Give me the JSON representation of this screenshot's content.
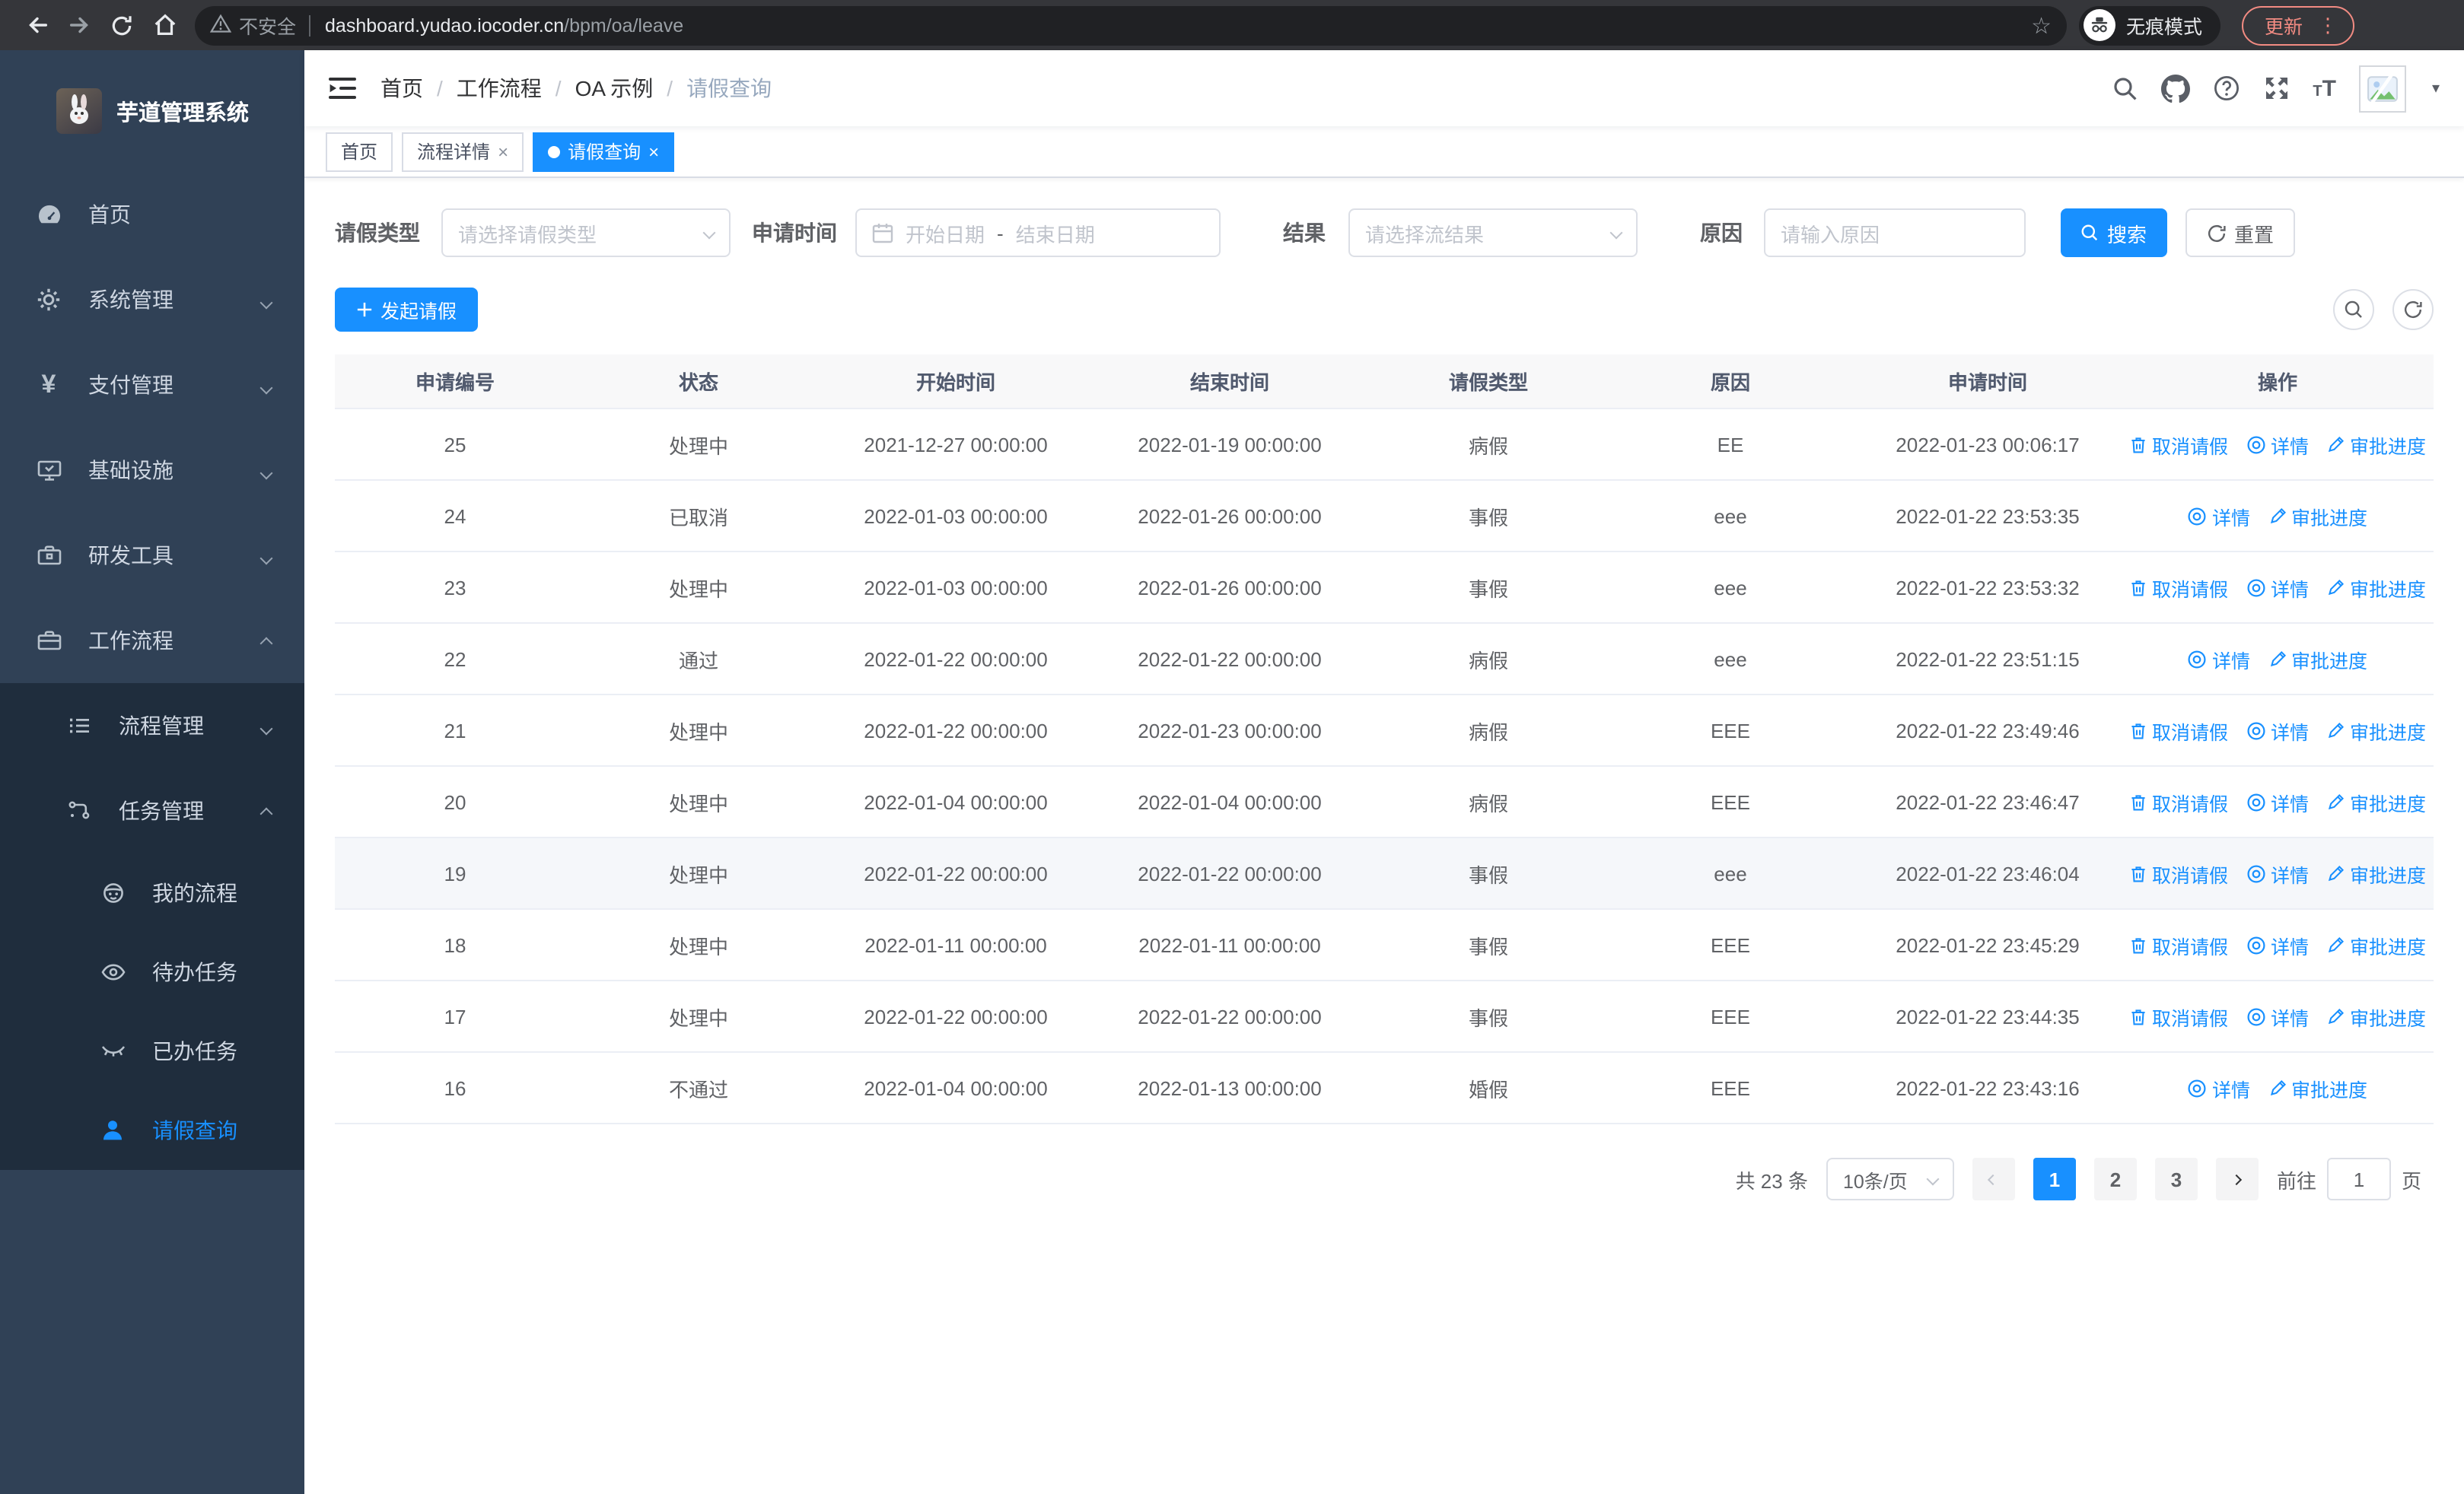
{
  "browser": {
    "security_label": "不安全",
    "url_host": "dashboard.yudao.iocoder.cn",
    "url_path": "/bpm/oa/leave",
    "incognito_label": "无痕模式",
    "update_label": "更新"
  },
  "sidebar": {
    "title": "芋道管理系统",
    "items": [
      {
        "label": "首页",
        "icon": "dashboard-icon",
        "level": 1
      },
      {
        "label": "系统管理",
        "icon": "gear-icon",
        "level": 1,
        "arrow": "down"
      },
      {
        "label": "支付管理",
        "icon": "yen-icon",
        "level": 1,
        "arrow": "down"
      },
      {
        "label": "基础设施",
        "icon": "monitor-icon",
        "level": 1,
        "arrow": "down"
      },
      {
        "label": "研发工具",
        "icon": "toolbox-icon",
        "level": 1,
        "arrow": "down"
      },
      {
        "label": "工作流程",
        "icon": "briefcase-icon",
        "level": 1,
        "arrow": "up"
      },
      {
        "label": "流程管理",
        "icon": "list-icon",
        "level": 2,
        "arrow": "down"
      },
      {
        "label": "任务管理",
        "icon": "flow-icon",
        "level": 2,
        "arrow": "up"
      },
      {
        "label": "我的流程",
        "icon": "robot-icon",
        "level": 3
      },
      {
        "label": "待办任务",
        "icon": "eye-icon",
        "level": 3
      },
      {
        "label": "已办任务",
        "icon": "eye-closed-icon",
        "level": 3
      },
      {
        "label": "请假查询",
        "icon": "user-icon",
        "level": 3,
        "active": true
      }
    ]
  },
  "breadcrumb": {
    "items": [
      "首页",
      "工作流程",
      "OA 示例",
      "请假查询"
    ]
  },
  "tabs": [
    {
      "label": "首页"
    },
    {
      "label": "流程详情",
      "closable": true
    },
    {
      "label": "请假查询",
      "closable": true,
      "active": true
    }
  ],
  "filters": {
    "leave_type_label": "请假类型",
    "leave_type_placeholder": "请选择请假类型",
    "apply_time_label": "申请时间",
    "start_date_placeholder": "开始日期",
    "range_separator": "-",
    "end_date_placeholder": "结束日期",
    "result_label": "结果",
    "result_placeholder": "请选择流结果",
    "reason_label": "原因",
    "reason_placeholder": "请输入原因",
    "search_label": "搜索",
    "reset_label": "重置"
  },
  "toolbar": {
    "create_label": "发起请假"
  },
  "table": {
    "columns": [
      "申请编号",
      "状态",
      "开始时间",
      "结束时间",
      "请假类型",
      "原因",
      "申请时间",
      "操作"
    ],
    "action_labels": {
      "cancel": "取消请假",
      "detail": "详情",
      "progress": "审批进度"
    },
    "rows": [
      {
        "id": "25",
        "status": "处理中",
        "start": "2021-12-27 00:00:00",
        "end": "2022-01-19 00:00:00",
        "type": "病假",
        "reason": "EE",
        "applied": "2022-01-23 00:06:17",
        "actions": [
          "cancel",
          "detail",
          "progress"
        ]
      },
      {
        "id": "24",
        "status": "已取消",
        "start": "2022-01-03 00:00:00",
        "end": "2022-01-26 00:00:00",
        "type": "事假",
        "reason": "eee",
        "applied": "2022-01-22 23:53:35",
        "actions": [
          "detail",
          "progress"
        ]
      },
      {
        "id": "23",
        "status": "处理中",
        "start": "2022-01-03 00:00:00",
        "end": "2022-01-26 00:00:00",
        "type": "事假",
        "reason": "eee",
        "applied": "2022-01-22 23:53:32",
        "actions": [
          "cancel",
          "detail",
          "progress"
        ]
      },
      {
        "id": "22",
        "status": "通过",
        "start": "2022-01-22 00:00:00",
        "end": "2022-01-22 00:00:00",
        "type": "病假",
        "reason": "eee",
        "applied": "2022-01-22 23:51:15",
        "actions": [
          "detail",
          "progress"
        ]
      },
      {
        "id": "21",
        "status": "处理中",
        "start": "2022-01-22 00:00:00",
        "end": "2022-01-23 00:00:00",
        "type": "病假",
        "reason": "EEE",
        "applied": "2022-01-22 23:49:46",
        "actions": [
          "cancel",
          "detail",
          "progress"
        ]
      },
      {
        "id": "20",
        "status": "处理中",
        "start": "2022-01-04 00:00:00",
        "end": "2022-01-04 00:00:00",
        "type": "病假",
        "reason": "EEE",
        "applied": "2022-01-22 23:46:47",
        "actions": [
          "cancel",
          "detail",
          "progress"
        ]
      },
      {
        "id": "19",
        "status": "处理中",
        "start": "2022-01-22 00:00:00",
        "end": "2022-01-22 00:00:00",
        "type": "事假",
        "reason": "eee",
        "applied": "2022-01-22 23:46:04",
        "actions": [
          "cancel",
          "detail",
          "progress"
        ],
        "highlight": true
      },
      {
        "id": "18",
        "status": "处理中",
        "start": "2022-01-11 00:00:00",
        "end": "2022-01-11 00:00:00",
        "type": "事假",
        "reason": "EEE",
        "applied": "2022-01-22 23:45:29",
        "actions": [
          "cancel",
          "detail",
          "progress"
        ]
      },
      {
        "id": "17",
        "status": "处理中",
        "start": "2022-01-22 00:00:00",
        "end": "2022-01-22 00:00:00",
        "type": "事假",
        "reason": "EEE",
        "applied": "2022-01-22 23:44:35",
        "actions": [
          "cancel",
          "detail",
          "progress"
        ]
      },
      {
        "id": "16",
        "status": "不通过",
        "start": "2022-01-04 00:00:00",
        "end": "2022-01-13 00:00:00",
        "type": "婚假",
        "reason": "EEE",
        "applied": "2022-01-22 23:43:16",
        "actions": [
          "detail",
          "progress"
        ]
      }
    ]
  },
  "pagination": {
    "total_label": "共 23 条",
    "page_size": "10条/页",
    "pages": [
      "1",
      "2",
      "3"
    ],
    "active_page": "1",
    "goto_label": "前往",
    "goto_value": "1",
    "page_suffix": "页"
  },
  "colors": {
    "accent": "#1890ff",
    "sidebar_bg": "#304156",
    "submenu_bg": "#1f2d3d"
  }
}
